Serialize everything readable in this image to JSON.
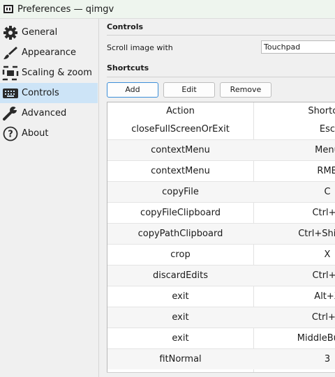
{
  "window": {
    "title": "Preferences — qimgv"
  },
  "sidebar": {
    "items": [
      {
        "label": "General",
        "icon": "gear-icon"
      },
      {
        "label": "Appearance",
        "icon": "brush-icon"
      },
      {
        "label": "Scaling & zoom",
        "icon": "scale-icon"
      },
      {
        "label": "Controls",
        "icon": "keyboard-icon",
        "selected": true
      },
      {
        "label": "Advanced",
        "icon": "wrench-icon"
      },
      {
        "label": "About",
        "icon": "help-icon"
      }
    ]
  },
  "controls": {
    "section_title": "Controls",
    "scroll_label": "Scroll image with",
    "scroll_value": "Touchpad"
  },
  "shortcuts": {
    "section_title": "Shortcuts",
    "buttons": {
      "add": "Add",
      "edit": "Edit",
      "remove": "Remove"
    },
    "columns": [
      "Action",
      "Shortcut"
    ],
    "rows": [
      {
        "action": "closeFullScreenOrExit",
        "shortcut": "Esc"
      },
      {
        "action": "contextMenu",
        "shortcut": "Menu"
      },
      {
        "action": "contextMenu",
        "shortcut": "RMB"
      },
      {
        "action": "copyFile",
        "shortcut": "C"
      },
      {
        "action": "copyFileClipboard",
        "shortcut": "Ctrl+C"
      },
      {
        "action": "copyPathClipboard",
        "shortcut": "Ctrl+Shift+C"
      },
      {
        "action": "crop",
        "shortcut": "X"
      },
      {
        "action": "discardEdits",
        "shortcut": "Ctrl+Z"
      },
      {
        "action": "exit",
        "shortcut": "Alt+X"
      },
      {
        "action": "exit",
        "shortcut": "Ctrl+Q"
      },
      {
        "action": "exit",
        "shortcut": "MiddleButton"
      },
      {
        "action": "fitNormal",
        "shortcut": "3"
      }
    ]
  },
  "colors": {
    "selection": "#cde4f7",
    "accent": "#3c8ed8"
  }
}
